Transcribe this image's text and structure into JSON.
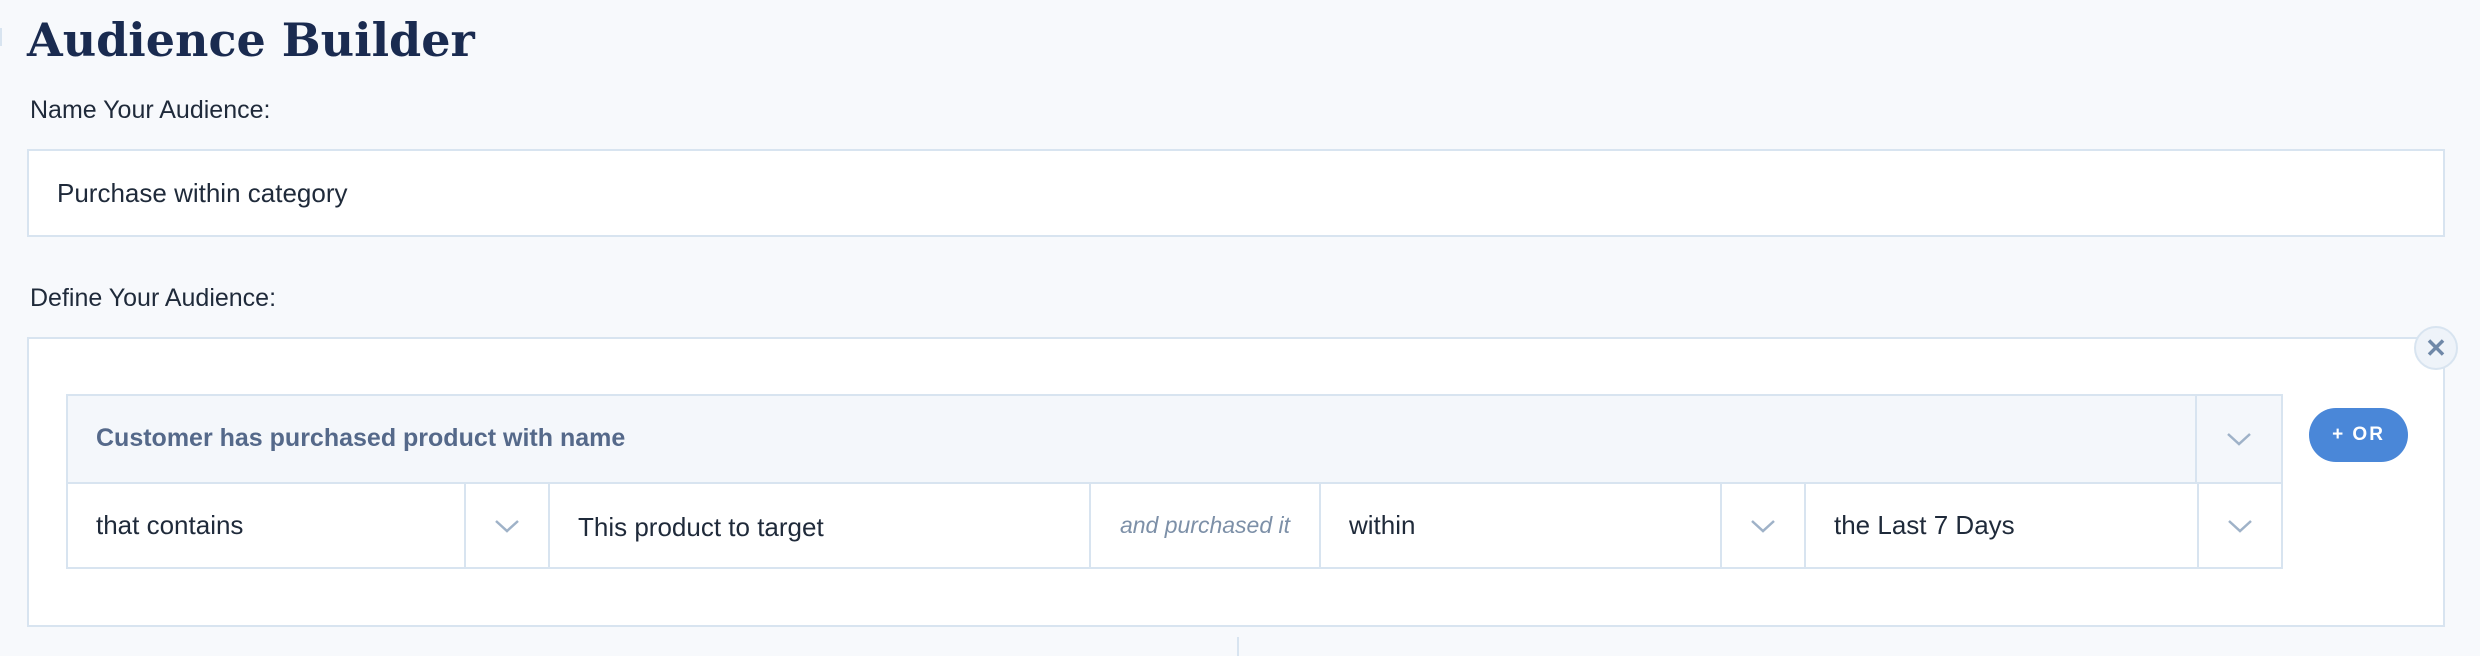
{
  "page": {
    "title": "Audience Builder"
  },
  "name_section": {
    "label": "Name Your Audience:",
    "value": "Purchase within category"
  },
  "define_section": {
    "label": "Define Your Audience:",
    "close_icon": "close-icon",
    "rule": {
      "condition": "Customer has purchased product with name",
      "operator": "that contains",
      "product_value": "This product to target",
      "connector": "and purchased it",
      "time_qualifier": "within",
      "time_range": "the Last 7 Days"
    },
    "or_button": "+ OR"
  },
  "colors": {
    "accent": "#4a87d8",
    "title": "#1a2b50",
    "border": "#d8e4f0",
    "muted_text": "#55698a"
  }
}
